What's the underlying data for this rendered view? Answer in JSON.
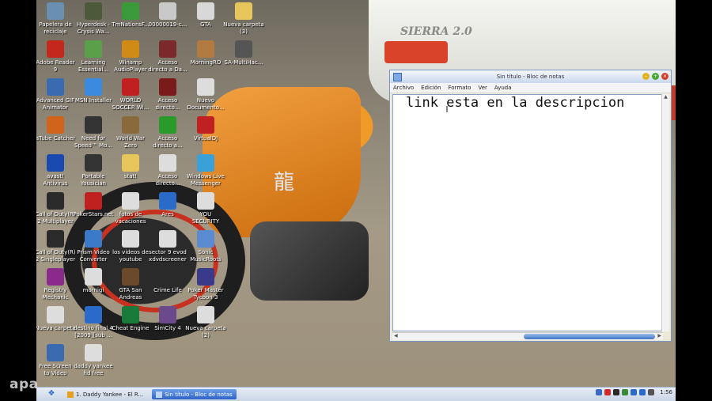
{
  "desktop": {
    "icons": [
      {
        "label": "Papelera de\nreciclaje",
        "icon": "recycle-bin-icon",
        "color": "#6a8fb0"
      },
      {
        "label": "Hyperdesk -\nCrysis Wa...",
        "icon": "game-icon",
        "color": "#4d5a3a"
      },
      {
        "label": "TmNationsF...",
        "icon": "game-icon",
        "color": "#3a9a3a"
      },
      {
        "label": "00000019-c...",
        "icon": "document-icon",
        "color": "#c9c9c9"
      },
      {
        "label": "GTA",
        "icon": "document-icon",
        "color": "#d8d8d8"
      },
      {
        "label": "Nueva carpeta\n(3)",
        "icon": "folder-icon",
        "color": "#e6c55a"
      },
      {
        "label": "Adobe Reader\n9",
        "icon": "pdf-icon",
        "color": "#c4281c"
      },
      {
        "label": "Learning\nEssential...",
        "icon": "app-icon",
        "color": "#5aa04a"
      },
      {
        "label": "Winamp\nAudioPlayer",
        "icon": "winamp-icon",
        "color": "#d08a18"
      },
      {
        "label": "Acceso\ndirecto a Da...",
        "icon": "game-icon",
        "color": "#7a2a2a"
      },
      {
        "label": "MorningRO",
        "icon": "game-icon",
        "color": "#b07a40"
      },
      {
        "label": "SA-MultiHac...",
        "icon": "app-icon",
        "color": "#555555"
      },
      {
        "label": "Advanced GIF\nAnimator",
        "icon": "app-icon",
        "color": "#3a6ab0"
      },
      {
        "label": "MSN Installer",
        "icon": "msn-icon",
        "color": "#3a8ae0"
      },
      {
        "label": "WORLD\nSOCCER Wi...",
        "icon": "game-icon",
        "color": "#c02020"
      },
      {
        "label": "Acceso\ndirecto...",
        "icon": "game-icon",
        "color": "#7a1a1a"
      },
      {
        "label": "Nuevo\nDocumento...",
        "icon": "document-icon",
        "color": "#dddddd"
      },
      {
        "label": "aTube Catcher",
        "icon": "app-icon",
        "color": "#d0641a"
      },
      {
        "label": "Need for\nSpeed™ Mo...",
        "icon": "game-icon",
        "color": "#333333"
      },
      {
        "label": "World War\nZero",
        "icon": "game-icon",
        "color": "#8a6a3a"
      },
      {
        "label": "Acceso\ndirecto a...",
        "icon": "play-icon",
        "color": "#2a9a2a"
      },
      {
        "label": "VirtualDJ",
        "icon": "dj-icon",
        "color": "#c02020"
      },
      {
        "label": "avast!\nAntivirus",
        "icon": "antivirus-icon",
        "color": "#1a4ab0"
      },
      {
        "label": "Portable\nYousician",
        "icon": "app-icon",
        "color": "#333333"
      },
      {
        "label": "stat!",
        "icon": "folder-icon",
        "color": "#e6c55a"
      },
      {
        "label": "Acceso\ndirecto...",
        "icon": "folder-icon",
        "color": "#dddddd"
      },
      {
        "label": "Windows Live\nMessenger",
        "icon": "messenger-icon",
        "color": "#3aa0d8"
      },
      {
        "label": "Call of Duty(R)\n2 Multiplayer",
        "icon": "game-icon",
        "color": "#2a2a2a"
      },
      {
        "label": "PokerStars.net",
        "icon": "poker-icon",
        "color": "#c02020"
      },
      {
        "label": "fotos de\nvacaciones",
        "icon": "folder-icon",
        "color": "#dddddd"
      },
      {
        "label": "Ares",
        "icon": "ares-icon",
        "color": "#2a6ac8"
      },
      {
        "label": "YOU\nSECURITY",
        "icon": "document-icon",
        "color": "#dddddd"
      },
      {
        "label": "Call of Duty(R)\n2 Singleplayer",
        "icon": "game-icon",
        "color": "#2a2a2a"
      },
      {
        "label": "Prism Video\nConverter",
        "icon": "app-icon",
        "color": "#3a7ac8"
      },
      {
        "label": "los videos de\nyoutube",
        "icon": "folder-icon",
        "color": "#dddddd"
      },
      {
        "label": "sector 9 evod\nxdvdscreener",
        "icon": "document-icon",
        "color": "#dddddd"
      },
      {
        "label": "Sonic\nMusicRoots",
        "icon": "app-icon",
        "color": "#5a8ad0"
      },
      {
        "label": "Registry\nMechanic",
        "icon": "app-icon",
        "color": "#8a2a8a"
      },
      {
        "label": "mornigi",
        "icon": "folder-icon",
        "color": "#dddddd"
      },
      {
        "label": "GTA San\nAndreas",
        "icon": "game-icon",
        "color": "#6a4a2a"
      },
      {
        "label": "Crime Life",
        "icon": "game-icon",
        "color": "#2a2a2a"
      },
      {
        "label": "Poker Master\nTycoon 3",
        "icon": "game-icon",
        "color": "#3a3a8a"
      },
      {
        "label": "Nueva carpeta",
        "icon": "folder-icon",
        "color": "#dddddd"
      },
      {
        "label": "destino final 4\n[2009][sub ...",
        "icon": "media-icon",
        "color": "#2a6ac8"
      },
      {
        "label": "Cheat Engine",
        "icon": "cheat-engine-icon",
        "color": "#1a7a3a"
      },
      {
        "label": "SimCity 4",
        "icon": "game-icon",
        "color": "#6a4a8a"
      },
      {
        "label": "Nueva carpeta\n(2)",
        "icon": "folder-icon",
        "color": "#dddddd"
      },
      {
        "label": "Free Screen\nto Video",
        "icon": "app-icon",
        "color": "#3a6ab0"
      },
      {
        "label": "daddy yankee\nhd free",
        "icon": "document-icon",
        "color": "#dddddd"
      }
    ],
    "car_badge": "SIERRA 2.0",
    "bike_kanji": "龍"
  },
  "notepad": {
    "title": "Sin título - Bloc de notas",
    "menu": [
      "Archivo",
      "Edición",
      "Formato",
      "Ver",
      "Ayuda"
    ],
    "content": "link esta en la descripcion"
  },
  "taskbar": {
    "tasks": [
      {
        "label": "1. Daddy Yankee - El R...",
        "active": false
      },
      {
        "label": "Sin título - Bloc de notas",
        "active": true
      }
    ],
    "clock": "1:56",
    "tray_colors": [
      "#3a6ac8",
      "#d02a2a",
      "#2a2a2a",
      "#3a8a3a",
      "#2a6ac8",
      "#2a6ac8",
      "#555555"
    ]
  },
  "watermark": "apa"
}
